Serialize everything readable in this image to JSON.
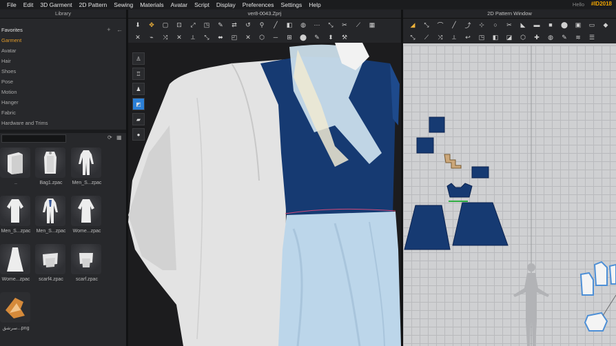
{
  "menu": [
    "File",
    "Edit",
    "3D Garment",
    "2D Pattern",
    "Sewing",
    "Materials",
    "Avatar",
    "Script",
    "Display",
    "Preferences",
    "Settings",
    "Help"
  ],
  "user": {
    "hello": "Hello",
    "id": "#ID2018"
  },
  "library": {
    "title": "Library",
    "tree": [
      "Favorites",
      "Garment",
      "Avatar",
      "Hair",
      "Shoes",
      "Pose",
      "Motion",
      "Hanger",
      "Fabric",
      "Hardware and Trims"
    ],
    "selected": "Garment",
    "actions": [
      "+",
      "←"
    ],
    "search_icons": [
      "refresh-icon",
      "grid-icon"
    ],
    "thumbs": [
      {
        "label": "..",
        "icon": "book-icon"
      },
      {
        "label": "Bag1.zpac",
        "icon": "garment-icon"
      },
      {
        "label": "Men_S...zpac",
        "icon": "garment-icon"
      },
      {
        "label": "Men_S...zpac",
        "icon": "garment-icon"
      },
      {
        "label": "Men_S...zpac",
        "icon": "garment-icon"
      },
      {
        "label": "Wome...zpac",
        "icon": "garment-icon"
      },
      {
        "label": "Wome...zpac",
        "icon": "garment-icon"
      },
      {
        "label": "scarf4.zpac",
        "icon": "garment-icon"
      },
      {
        "label": "scarf.zpac",
        "icon": "garment-icon"
      },
      {
        "label": "سرشق...png",
        "icon": "image-icon"
      }
    ]
  },
  "view3d": {
    "title": "ver8-0043.Zprj"
  },
  "view2d": {
    "title": "2D Pattern Window"
  },
  "colors": {
    "accent": "#f0a500",
    "navy": "#163a72",
    "lightblue": "#bcd6ea",
    "white_garment": "#e9e9e9"
  }
}
